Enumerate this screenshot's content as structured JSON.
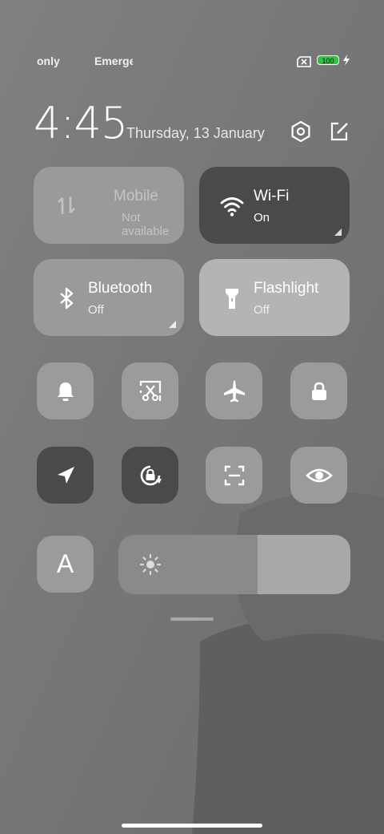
{
  "status_bar": {
    "carrier_1": "only",
    "carrier_2": "Emergency",
    "battery_level": "100",
    "battery_color": "#35c046"
  },
  "header": {
    "time": "4:45",
    "date": "Thursday, 13 January",
    "icons": [
      "settings-icon",
      "edit-icon"
    ]
  },
  "tiles": {
    "mobile": {
      "name": "Mobile",
      "status": "Not available",
      "icon": "mobile-data-icon"
    },
    "wifi": {
      "name": "Wi-Fi",
      "status": "On",
      "icon": "wifi-icon"
    },
    "bluetooth": {
      "name": "Bluetooth",
      "status": "Off",
      "icon": "bluetooth-icon"
    },
    "flashlight": {
      "name": "Flashlight",
      "status": "Off",
      "icon": "flashlight-icon"
    }
  },
  "toggles_row_1": [
    "bell-icon",
    "screenshot-icon",
    "airplane-icon",
    "lock-icon"
  ],
  "toggles_row_2": [
    "location-icon",
    "rotation-lock-icon",
    "scanner-icon",
    "eye-icon"
  ],
  "font_toggle_label": "A",
  "brightness": {
    "level": 0.4,
    "icon": "sun-icon"
  },
  "colors": {
    "active_tile": "#4a4a4a",
    "inactive_tile": "#9a9a9a",
    "background": "#7b7b7b"
  }
}
